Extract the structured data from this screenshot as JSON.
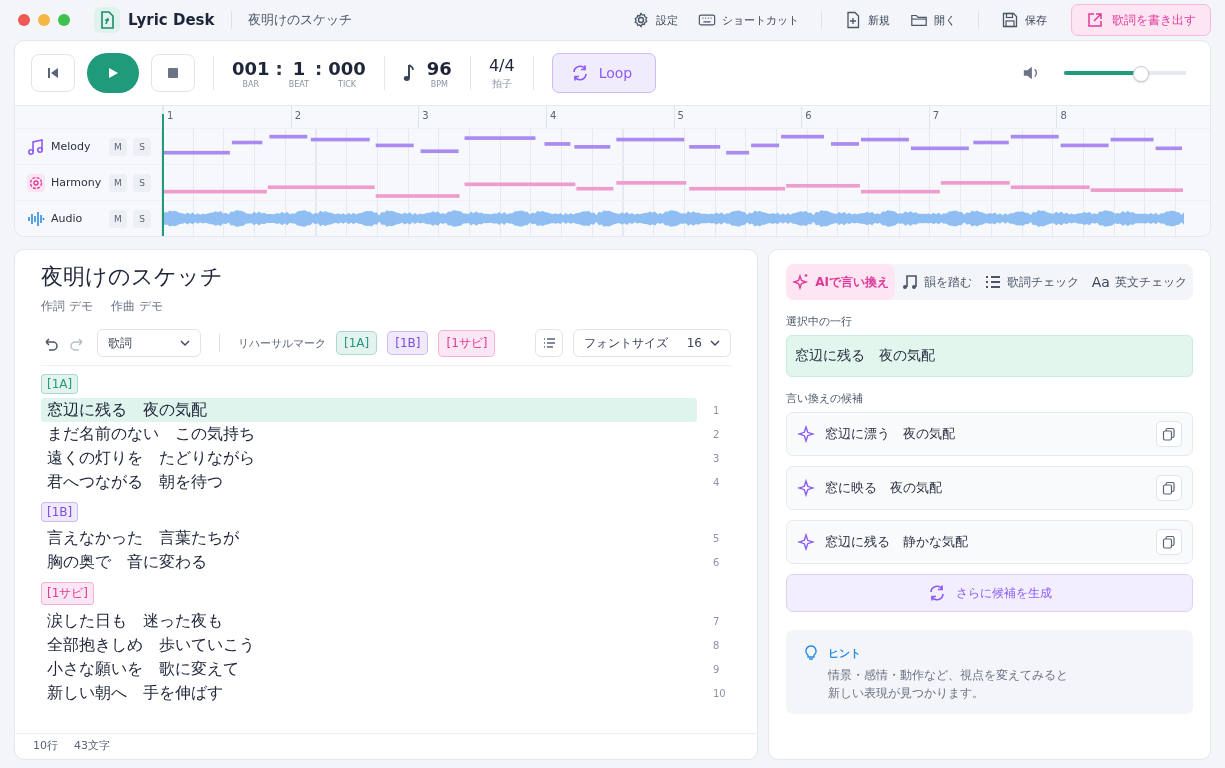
{
  "app": {
    "name": "Lyric Desk",
    "document": "夜明けのスケッチ"
  },
  "toolbar": [
    {
      "kind": "settings",
      "label": "設定"
    },
    {
      "kind": "keyboard",
      "label": "ショートカット"
    },
    {
      "kind": "new",
      "label": "新規"
    },
    {
      "kind": "open",
      "label": "開く"
    },
    {
      "kind": "save",
      "label": "保存"
    }
  ],
  "export_button": "歌詞を書き出す",
  "transport": {
    "position": [
      {
        "value": "001",
        "label": "BAR"
      },
      {
        "value": "1",
        "label": "BEAT"
      },
      {
        "value": "000",
        "label": "TICK"
      }
    ],
    "separator": ":",
    "tempo": {
      "value": "96",
      "unit": "BPM"
    },
    "meter": {
      "value": "4/4",
      "label": "拍子"
    },
    "loop": {
      "label": "Loop",
      "on": true
    },
    "volume": {
      "level": 0.63
    }
  },
  "ruler": [
    "1",
    "2",
    "3",
    "4",
    "5",
    "6",
    "7",
    "8"
  ],
  "tracks": [
    {
      "kind": "melody",
      "name": "Melody",
      "mute": "M",
      "solo": "S"
    },
    {
      "kind": "harmony",
      "name": "Harmony",
      "mute": "M",
      "solo": "S"
    },
    {
      "kind": "audio",
      "name": "Audio",
      "mute": "M",
      "solo": "S"
    }
  ],
  "editor": {
    "title": "夜明けのスケッチ",
    "credits": [
      {
        "label": "作詞",
        "value": "デモ"
      },
      {
        "label": "作曲",
        "value": "デモ"
      }
    ],
    "view_select": "歌詞",
    "rehearsal_label": "リハーサルマーク",
    "marks": [
      {
        "label": "[1A]",
        "color": "#1f9a7a"
      },
      {
        "label": "[1B]",
        "color": "#7c4ddb"
      },
      {
        "label": "[1サビ]",
        "color": "#e0399a"
      }
    ],
    "font_size": {
      "label": "フォントサイズ",
      "value": "16"
    },
    "sections": [
      {
        "mark": "[1A]",
        "color": "#1f9a7a",
        "lines": [
          {
            "text": "窓辺に残る　夜の気配",
            "number": "1",
            "selected": true
          },
          {
            "text": "まだ名前のない　この気持ち",
            "number": "2",
            "selected": false
          },
          {
            "text": "遠くの灯りを　たどりながら",
            "number": "3",
            "selected": false
          },
          {
            "text": "君へつながる　朝を待つ",
            "number": "4",
            "selected": false
          }
        ]
      },
      {
        "mark": "[1B]",
        "color": "#7c4ddb",
        "lines": [
          {
            "text": "言えなかった　言葉たちが",
            "number": "5",
            "selected": false
          },
          {
            "text": "胸の奥で　音に変わる",
            "number": "6",
            "selected": false
          }
        ]
      },
      {
        "mark": "[1サビ]",
        "color": "#e0399a",
        "lines": [
          {
            "text": "涙した日も　迷った夜も",
            "number": "7",
            "selected": false
          },
          {
            "text": "全部抱きしめ　歩いていこう",
            "number": "8",
            "selected": false
          },
          {
            "text": "小さな願いを　歌に変えて",
            "number": "9",
            "selected": false
          },
          {
            "text": "新しい朝へ　手を伸ばす",
            "number": "10",
            "selected": false
          }
        ]
      }
    ],
    "status": [
      "10行",
      "43文字"
    ]
  },
  "assistant": {
    "tabs": [
      {
        "kind": "sparkle",
        "label": "AIで言い換え",
        "selected": true
      },
      {
        "kind": "note",
        "label": "韻を踏む",
        "selected": false
      },
      {
        "kind": "list",
        "label": "歌詞チェック",
        "selected": false
      },
      {
        "kind": "letters",
        "label": "英文チェック",
        "icon_text": "Aa",
        "selected": false
      }
    ],
    "selected_label": "選択中の一行",
    "selected_line": "窓辺に残る　夜の気配",
    "candidates_label": "言い換えの候補",
    "candidates": [
      "窓辺に漂う　夜の気配",
      "窓に映る　夜の気配",
      "窓辺に残る　静かな気配"
    ],
    "generate_button": "さらに候補を生成",
    "hint": {
      "title": "ヒント",
      "lines": [
        "情景・感情・動作など、視点を変えてみると",
        "新しい表現が見つかります。"
      ]
    }
  }
}
